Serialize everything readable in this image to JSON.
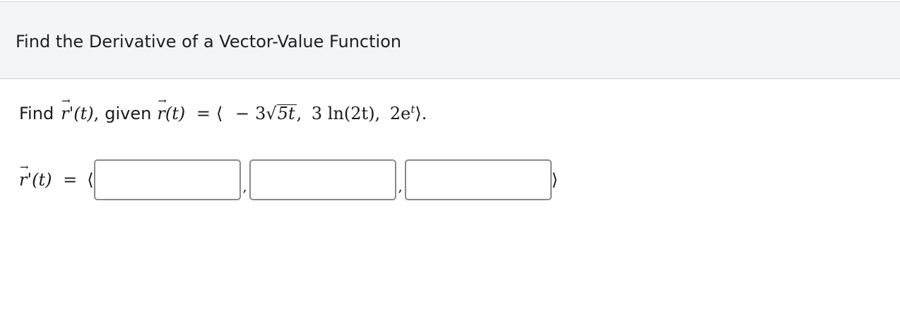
{
  "header": {
    "title": "Find the Derivative of a Vector-Value Function"
  },
  "question": {
    "prefix": "Find",
    "given_word": "given",
    "vector_symbol": "r",
    "prime": "'",
    "paren_t": "(t)",
    "comma_after_prime": ",",
    "equals": "=",
    "open_angle": "⟨",
    "component_1_sign": "−",
    "component_1_coeff": "3",
    "component_1_radicand": "5t",
    "component_2": "3 ln(2t)",
    "component_3_base": "2e",
    "component_3_exp": "t",
    "close_angle": "⟩",
    "period": "."
  },
  "answer": {
    "lhs_symbol": "r",
    "lhs_prime": "'",
    "lhs_paren": "(t)",
    "equals": "=",
    "open_angle": "⟨",
    "close_angle": "⟩",
    "separator": ",",
    "inputs": [
      {
        "value": ""
      },
      {
        "value": ""
      },
      {
        "value": ""
      }
    ]
  }
}
